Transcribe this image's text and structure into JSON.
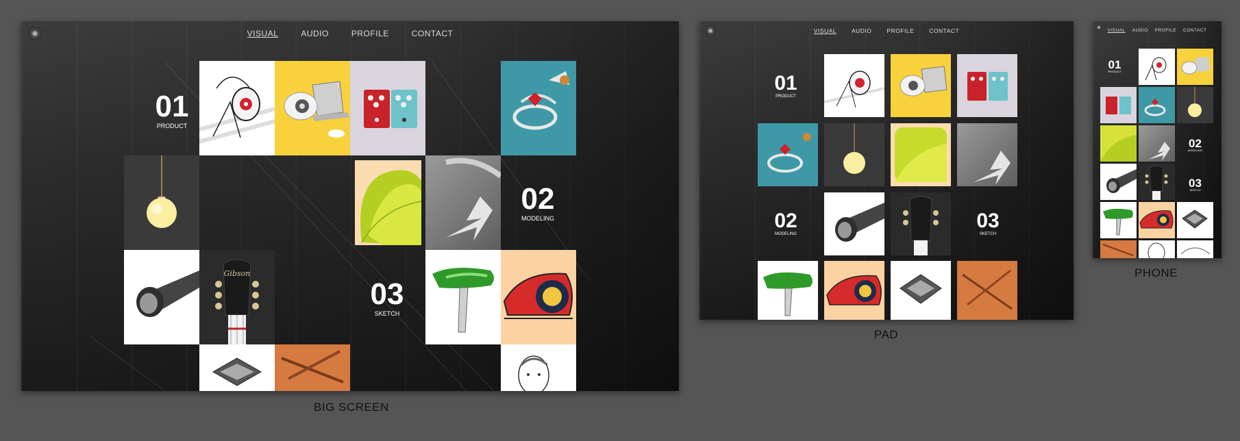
{
  "nav_items": [
    "VISUAL",
    "AUDIO",
    "PROFILE",
    "CONTACT"
  ],
  "sections": [
    {
      "num": "01",
      "label": "PRODUCT"
    },
    {
      "num": "02",
      "label": "MODELING"
    },
    {
      "num": "03",
      "label": "SKETCH"
    }
  ],
  "captions": {
    "big": "BIG SCREEN",
    "pad": "PAD",
    "phone": "PHONE"
  },
  "thumbnails": {
    "sketch_lamp": "sketch-lamp-icon",
    "speaker": "speaker-laptop-icon",
    "pedals": "effect-pedals-icon",
    "ring": "ring-jewelry-icon",
    "bulb": "pendant-bulb-icon",
    "leaf": "ginkgo-leaf-icon",
    "arrow": "arrow-render-icon",
    "mic": "microphone-icon",
    "guitar": "guitar-headstock-icon",
    "dryer": "hair-dryer-icon",
    "car": "concept-car-icon",
    "cube": "cube-device-icon",
    "pens": "pens-icon",
    "portrait": "portrait-sketch-icon"
  }
}
